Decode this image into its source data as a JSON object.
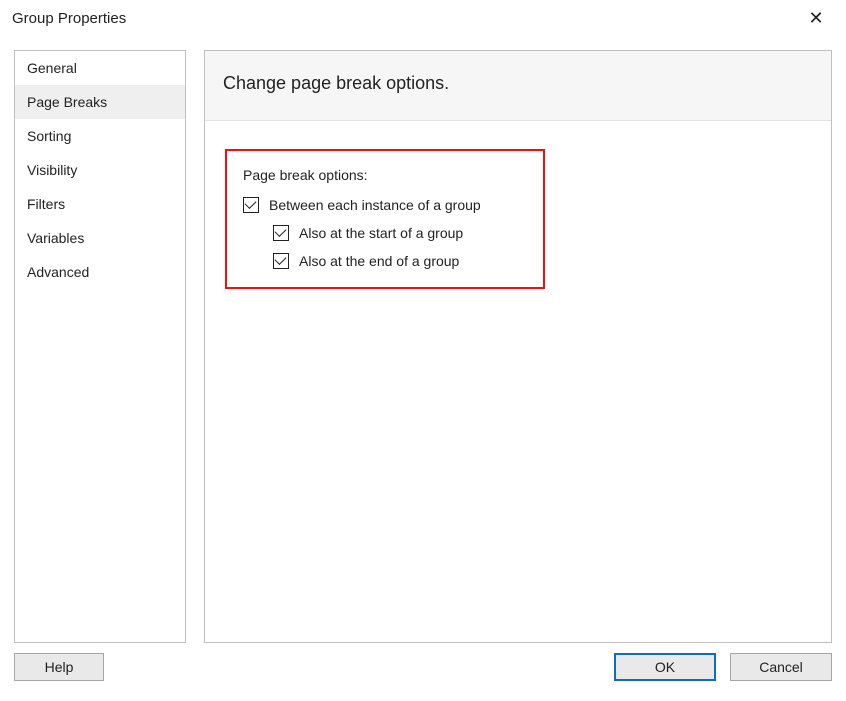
{
  "titlebar": {
    "title": "Group Properties"
  },
  "sidebar": {
    "items": [
      {
        "label": "General",
        "selected": false
      },
      {
        "label": "Page Breaks",
        "selected": true
      },
      {
        "label": "Sorting",
        "selected": false
      },
      {
        "label": "Visibility",
        "selected": false
      },
      {
        "label": "Filters",
        "selected": false
      },
      {
        "label": "Variables",
        "selected": false
      },
      {
        "label": "Advanced",
        "selected": false
      }
    ]
  },
  "main": {
    "heading": "Change page break options.",
    "options_title": "Page break options:",
    "checkboxes": {
      "between": {
        "label": "Between each instance of a group",
        "checked": true
      },
      "at_start": {
        "label": "Also at the start of a group",
        "checked": true
      },
      "at_end": {
        "label": "Also at the end of a group",
        "checked": true
      }
    }
  },
  "footer": {
    "help": "Help",
    "ok": "OK",
    "cancel": "Cancel"
  },
  "highlight_color": "#e11"
}
